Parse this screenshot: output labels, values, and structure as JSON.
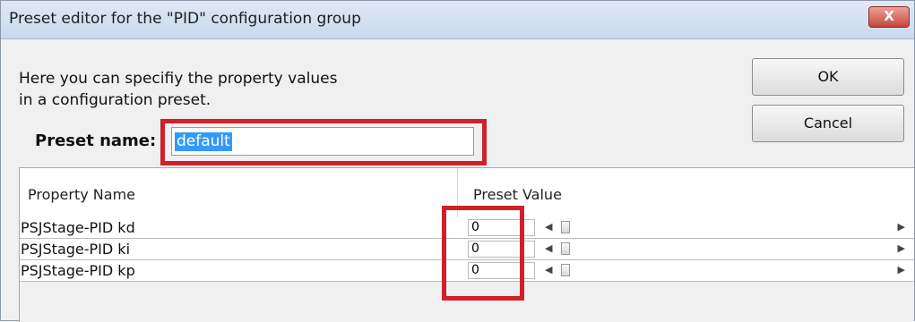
{
  "window": {
    "title": "Preset editor for the \"PID\" configuration group",
    "close_label": "X"
  },
  "description": {
    "line1": "Here you can specifiy the property values",
    "line2": "in a configuration preset."
  },
  "buttons": {
    "ok": "OK",
    "cancel": "Cancel"
  },
  "preset": {
    "label": "Preset name:",
    "value": "default"
  },
  "table": {
    "headers": [
      "Property Name",
      "Preset Value"
    ],
    "rows": [
      {
        "name": "PSJStage-PID kd",
        "value": "0"
      },
      {
        "name": "PSJStage-PID ki",
        "value": "0"
      },
      {
        "name": "PSJStage-PID kp",
        "value": "0"
      }
    ]
  },
  "colors": {
    "highlight": "#d0202c",
    "selection": "#3399ff"
  },
  "icons": {
    "slider_left": "arrow-left-icon",
    "slider_right": "arrow-right-icon"
  }
}
